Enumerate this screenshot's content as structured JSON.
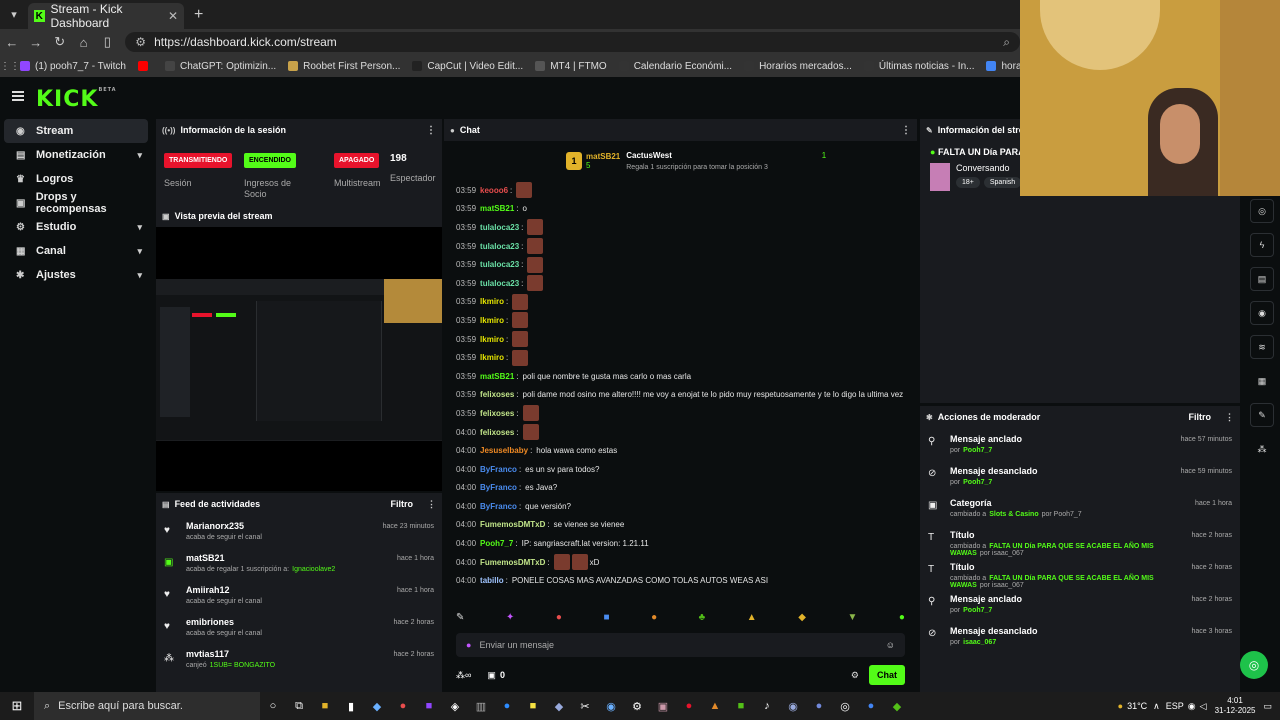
{
  "browser": {
    "tab_title": "Stream - Kick Dashboard",
    "url": "https://dashboard.kick.com/stream",
    "bookmarks": [
      {
        "label": "(1) pooh7_7 - Twitch",
        "color": "#9146ff"
      },
      {
        "label": "",
        "color": "#ff0000"
      },
      {
        "label": "ChatGPT: Optimizin...",
        "color": "#444"
      },
      {
        "label": "Roobet First Person...",
        "color": "#c8a24a"
      },
      {
        "label": "CapCut | Video Edit...",
        "color": "#222"
      },
      {
        "label": "MT4 | FTMO",
        "color": "#555"
      },
      {
        "label": "Calendario Económi...",
        "color": "#333"
      },
      {
        "label": "Horarios mercados...",
        "color": "#333"
      },
      {
        "label": "Últimas noticias - In...",
        "color": "#333"
      },
      {
        "label": "hora gmt - Buscar c...",
        "color": "#4285f4"
      },
      {
        "label": "FTMO - For Serio",
        "color": "#555"
      }
    ]
  },
  "brand": {
    "logo": "KICK",
    "beta": "BETA"
  },
  "sidebar": {
    "items": [
      {
        "label": "Stream",
        "icon": "stream-icon",
        "glyph": "◉",
        "chev": ""
      },
      {
        "label": "Monetización",
        "icon": "money-icon",
        "glyph": "▤",
        "chev": "▾"
      },
      {
        "label": "Logros",
        "icon": "trophy-icon",
        "glyph": "♛",
        "chev": ""
      },
      {
        "label": "Drops y recompensas",
        "icon": "gift-icon",
        "glyph": "▣",
        "chev": ""
      },
      {
        "label": "Estudio",
        "icon": "studio-icon",
        "glyph": "⚙",
        "chev": "▾"
      },
      {
        "label": "Canal",
        "icon": "channel-icon",
        "glyph": "▦",
        "chev": "▾"
      },
      {
        "label": "Ajustes",
        "icon": "gear-icon",
        "glyph": "✱",
        "chev": "▾"
      }
    ]
  },
  "session": {
    "title": "Información de la sesión",
    "badges": [
      {
        "text": "TRANSMITIENDO",
        "label": "Sesión",
        "bg": "#e8132c",
        "fg": "#ffffff"
      },
      {
        "text": "ENCENDIDO",
        "label": "Ingresos de Socio",
        "bg": "#53fc18",
        "fg": "#000000"
      },
      {
        "text": "APAGADO",
        "label": "Multistream",
        "bg": "#e8132c",
        "fg": "#ffffff"
      }
    ],
    "viewers": "198",
    "viewers_label": "Espectador"
  },
  "preview": {
    "title": "Vista previa del stream"
  },
  "feed": {
    "title": "Feed de actividades",
    "filter": "Filtro",
    "items": [
      {
        "name": "Marianorx235",
        "sub": "acaba de seguir el canal",
        "extra": "",
        "time": "hace 23 minutos",
        "glyph": "♥"
      },
      {
        "name": "matSB21",
        "sub": "acaba de regalar 1 suscripción a:",
        "extra": "Ignacioolave2",
        "time": "hace 1 hora",
        "glyph": "▣"
      },
      {
        "name": "Amiirah12",
        "sub": "acaba de seguir el canal",
        "extra": "",
        "time": "hace 1 hora",
        "glyph": "♥"
      },
      {
        "name": "emibriones",
        "sub": "acaba de seguir el canal",
        "extra": "",
        "time": "hace 2 horas",
        "glyph": "♥"
      },
      {
        "name": "mvtias117",
        "sub": "canjeó",
        "extra": "1SUB= BONGAZITO",
        "time": "hace 2 horas",
        "glyph": "⁂"
      }
    ]
  },
  "chat": {
    "title": "Chat",
    "pinned": {
      "gifter": "matSB21",
      "gifter_count": "5",
      "leader": "CactusWest",
      "leader_count": "1",
      "note": "Regala 1 suscripción para tomar la posición 3"
    },
    "messages": [
      {
        "time": "03:59",
        "user": "keooo6",
        "color": "#e84d4d",
        "text": "",
        "emotes": 1
      },
      {
        "time": "03:59",
        "user": "matSB21",
        "color": "#53fc18",
        "text": "o",
        "emotes": 0
      },
      {
        "time": "03:59",
        "user": "tulaloca23",
        "color": "#6ae0a6",
        "text": "",
        "emotes": 1
      },
      {
        "time": "03:59",
        "user": "tulaloca23",
        "color": "#6ae0a6",
        "text": "",
        "emotes": 1
      },
      {
        "time": "03:59",
        "user": "tulaloca23",
        "color": "#6ae0a6",
        "text": "",
        "emotes": 1
      },
      {
        "time": "03:59",
        "user": "tulaloca23",
        "color": "#6ae0a6",
        "text": "",
        "emotes": 1
      },
      {
        "time": "03:59",
        "user": "lkmiro",
        "color": "#e6e600",
        "text": "",
        "emotes": 1
      },
      {
        "time": "03:59",
        "user": "lkmiro",
        "color": "#e6e600",
        "text": "",
        "emotes": 1
      },
      {
        "time": "03:59",
        "user": "lkmiro",
        "color": "#e6e600",
        "text": "",
        "emotes": 1
      },
      {
        "time": "03:59",
        "user": "lkmiro",
        "color": "#e6e600",
        "text": "",
        "emotes": 1
      },
      {
        "time": "03:59",
        "user": "matSB21",
        "color": "#53fc18",
        "text": "poli que nombre te gusta mas carlo o mas carla",
        "emotes": 0
      },
      {
        "time": "03:59",
        "user": "felixoses",
        "color": "#c2e58a",
        "text": "poli dame mod osino me altero!!!! me voy a enojat te lo pido muy respetuosamente y te lo digo la ultima vez",
        "emotes": 0
      },
      {
        "time": "03:59",
        "user": "felixoses",
        "color": "#c2e58a",
        "text": "",
        "emotes": 1
      },
      {
        "time": "04:00",
        "user": "felixoses",
        "color": "#c2e58a",
        "text": "",
        "emotes": 1
      },
      {
        "time": "04:00",
        "user": "Jesuselbaby",
        "color": "#f08a24",
        "text": "hola wawa como estas",
        "emotes": 0
      },
      {
        "time": "04:00",
        "user": "ByFranco",
        "color": "#4a8cf0",
        "text": "es un sv para todos?",
        "emotes": 0
      },
      {
        "time": "04:00",
        "user": "ByFranco",
        "color": "#4a8cf0",
        "text": "es Java?",
        "emotes": 0
      },
      {
        "time": "04:00",
        "user": "ByFranco",
        "color": "#4a8cf0",
        "text": "que versión?",
        "emotes": 0
      },
      {
        "time": "04:00",
        "user": "FumemosDMTxD",
        "color": "#c2e58a",
        "text": "se vienee se vienee",
        "emotes": 0
      },
      {
        "time": "04:00",
        "user": "Pooh7_7",
        "color": "#53fc18",
        "text": "IP: sangriascraft.lat version: 1.21.11",
        "emotes": 0
      },
      {
        "time": "04:00",
        "user": "FumemosDMTxD",
        "color": "#c2e58a",
        "text": "xD",
        "emotes": 2
      },
      {
        "time": "04:00",
        "user": "tabillo",
        "color": "#a0c4ff",
        "text": "PONELE COSAS MAS AVANZADAS COMO TOLAS AUTOS WEAS ASI",
        "emotes": 0
      }
    ],
    "input_placeholder": "Enviar un mensaje",
    "points": "0",
    "send_label": "Chat"
  },
  "stream_info": {
    "title": "Información del stre",
    "stream_title": "FALTA UN Día PARA",
    "category": "Conversando",
    "tags": [
      "18+",
      "Spanish"
    ]
  },
  "mod": {
    "title": "Acciones de moderador",
    "filter": "Filtro",
    "items": [
      {
        "title": "Mensaje anclado",
        "sub": "por",
        "sub2": "Pooh7_7",
        "sub3": "",
        "time": "hace 57 minutos",
        "glyph": "⚲"
      },
      {
        "title": "Mensaje desanclado",
        "sub": "por",
        "sub2": "Pooh7_7",
        "sub3": "",
        "time": "hace 59 minutos",
        "glyph": "⊘"
      },
      {
        "title": "Categoría",
        "sub": "cambiado a",
        "sub2": "Slots & Casino",
        "sub3": "por Pooh7_7",
        "time": "hace 1 hora",
        "glyph": "▣"
      },
      {
        "title": "Título",
        "sub": "cambiado a",
        "sub2": "FALTA UN Día PARA QUE SE ACABE EL AÑO MIS WAWAS",
        "sub3": "por isaac_067",
        "time": "hace 2 horas",
        "glyph": "T"
      },
      {
        "title": "Título",
        "sub": "cambiado a",
        "sub2": "FALTA UN Día PARA QUE SE ACABE EL AÑO MIS WAWAS",
        "sub3": "por isaac_067",
        "time": "hace 2 horas",
        "glyph": "T"
      },
      {
        "title": "Mensaje anclado",
        "sub": "por",
        "sub2": "Pooh7_7",
        "sub3": "",
        "time": "hace 2 horas",
        "glyph": "⚲"
      },
      {
        "title": "Mensaje desanclado",
        "sub": "por",
        "sub2": "isaac_067",
        "sub3": "",
        "time": "hace 3 horas",
        "glyph": "⊘"
      }
    ]
  },
  "taskbar": {
    "search_placeholder": "Escribe aquí para buscar.",
    "weather": "31°C",
    "lang": "ESP",
    "time": "4:01",
    "date": "31-12-2025"
  }
}
